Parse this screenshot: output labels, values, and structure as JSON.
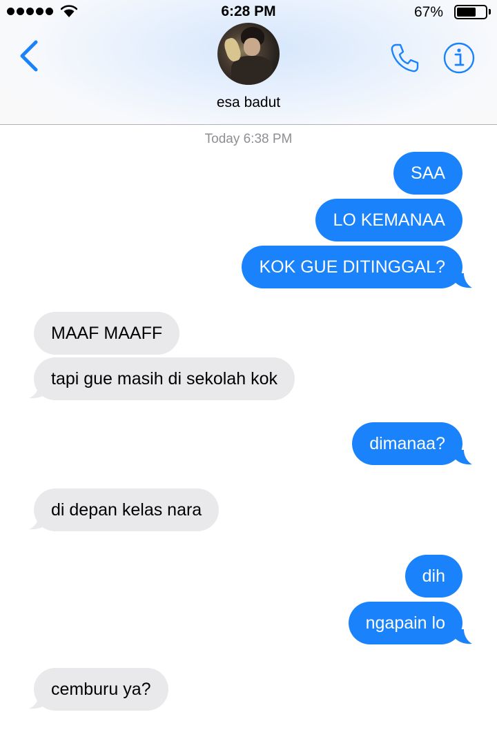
{
  "status_bar": {
    "signal_dots": 5,
    "time": "6:28 PM",
    "battery_percent": "67%",
    "battery_level": 0.67
  },
  "header": {
    "contact_name": "esa badut",
    "icons": [
      "back-chevron-icon",
      "phone-icon",
      "info-icon"
    ]
  },
  "colors": {
    "accent": "#1a82fb",
    "sent_bubble": "#1a82fb",
    "received_bubble": "#e9e9eb",
    "timestamp_text": "#8e8e93"
  },
  "thread": {
    "timestamp": "Today 6:38 PM",
    "messages": [
      {
        "direction": "sent",
        "text": "SAA"
      },
      {
        "direction": "sent",
        "text": "LO KEMANAA"
      },
      {
        "direction": "sent",
        "text": "KOK GUE DITINGGAL?"
      },
      {
        "direction": "received",
        "text": "MAAF MAAFF"
      },
      {
        "direction": "received",
        "text": "tapi gue masih di sekolah kok"
      },
      {
        "direction": "sent",
        "text": "dimanaa?"
      },
      {
        "direction": "received",
        "text": "di depan kelas nara"
      },
      {
        "direction": "sent",
        "text": "dih"
      },
      {
        "direction": "sent",
        "text": "ngapain lo"
      },
      {
        "direction": "received",
        "text": "cemburu ya?"
      }
    ]
  }
}
